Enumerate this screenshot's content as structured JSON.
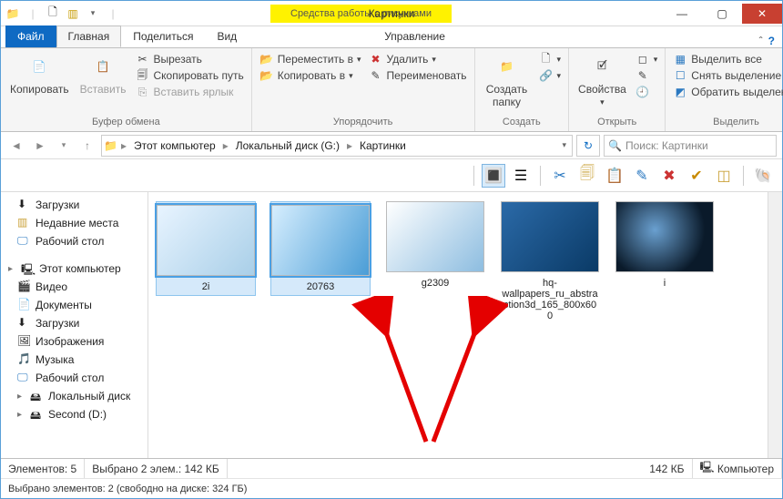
{
  "title": "Картинки",
  "context_tab": "Средства работы с рисунками",
  "tabs": {
    "file": "Файл",
    "home": "Главная",
    "share": "Поделиться",
    "view": "Вид",
    "manage": "Управление"
  },
  "ribbon": {
    "clipboard": {
      "label": "Буфер обмена",
      "copy": "Копировать",
      "paste": "Вставить",
      "cut": "Вырезать",
      "copy_path": "Скопировать путь",
      "paste_shortcut": "Вставить ярлык"
    },
    "organize": {
      "label": "Упорядочить",
      "move_to": "Переместить в",
      "copy_to": "Копировать в",
      "delete": "Удалить",
      "rename": "Переименовать"
    },
    "new": {
      "label": "Создать",
      "new_folder": "Создать папку"
    },
    "open": {
      "label": "Открыть",
      "properties": "Свойства"
    },
    "select": {
      "label": "Выделить",
      "select_all": "Выделить все",
      "select_none": "Снять выделение",
      "invert": "Обратить выделение"
    }
  },
  "breadcrumb": {
    "items": [
      "Этот компьютер",
      "Локальный диск (G:)",
      "Картинки"
    ]
  },
  "search_placeholder": "Поиск: Картинки",
  "tree": {
    "downloads": "Загрузки",
    "recent": "Недавние места",
    "desktop": "Рабочий стол",
    "this_pc": "Этот компьютер",
    "video": "Видео",
    "documents": "Документы",
    "downloads2": "Загрузки",
    "pictures": "Изображения",
    "music": "Музыка",
    "desktop2": "Рабочий стол",
    "local_disk": "Локальный диск",
    "second_d": "Second (D:)"
  },
  "files": [
    {
      "name": "2i",
      "selected": true
    },
    {
      "name": "20763",
      "selected": true
    },
    {
      "name": "g2309",
      "selected": false
    },
    {
      "name": "hq-wallpapers_ru_abstraction3d_165_800x600",
      "selected": false
    },
    {
      "name": "i",
      "selected": false
    }
  ],
  "status": {
    "count": "Элементов: 5",
    "selection": "Выбрано 2 элем.: 142 КБ",
    "size": "142 КБ",
    "computer": "Компьютер"
  },
  "details_bar": "Выбрано элементов: 2 (свободно на диске: 324 ГБ)"
}
